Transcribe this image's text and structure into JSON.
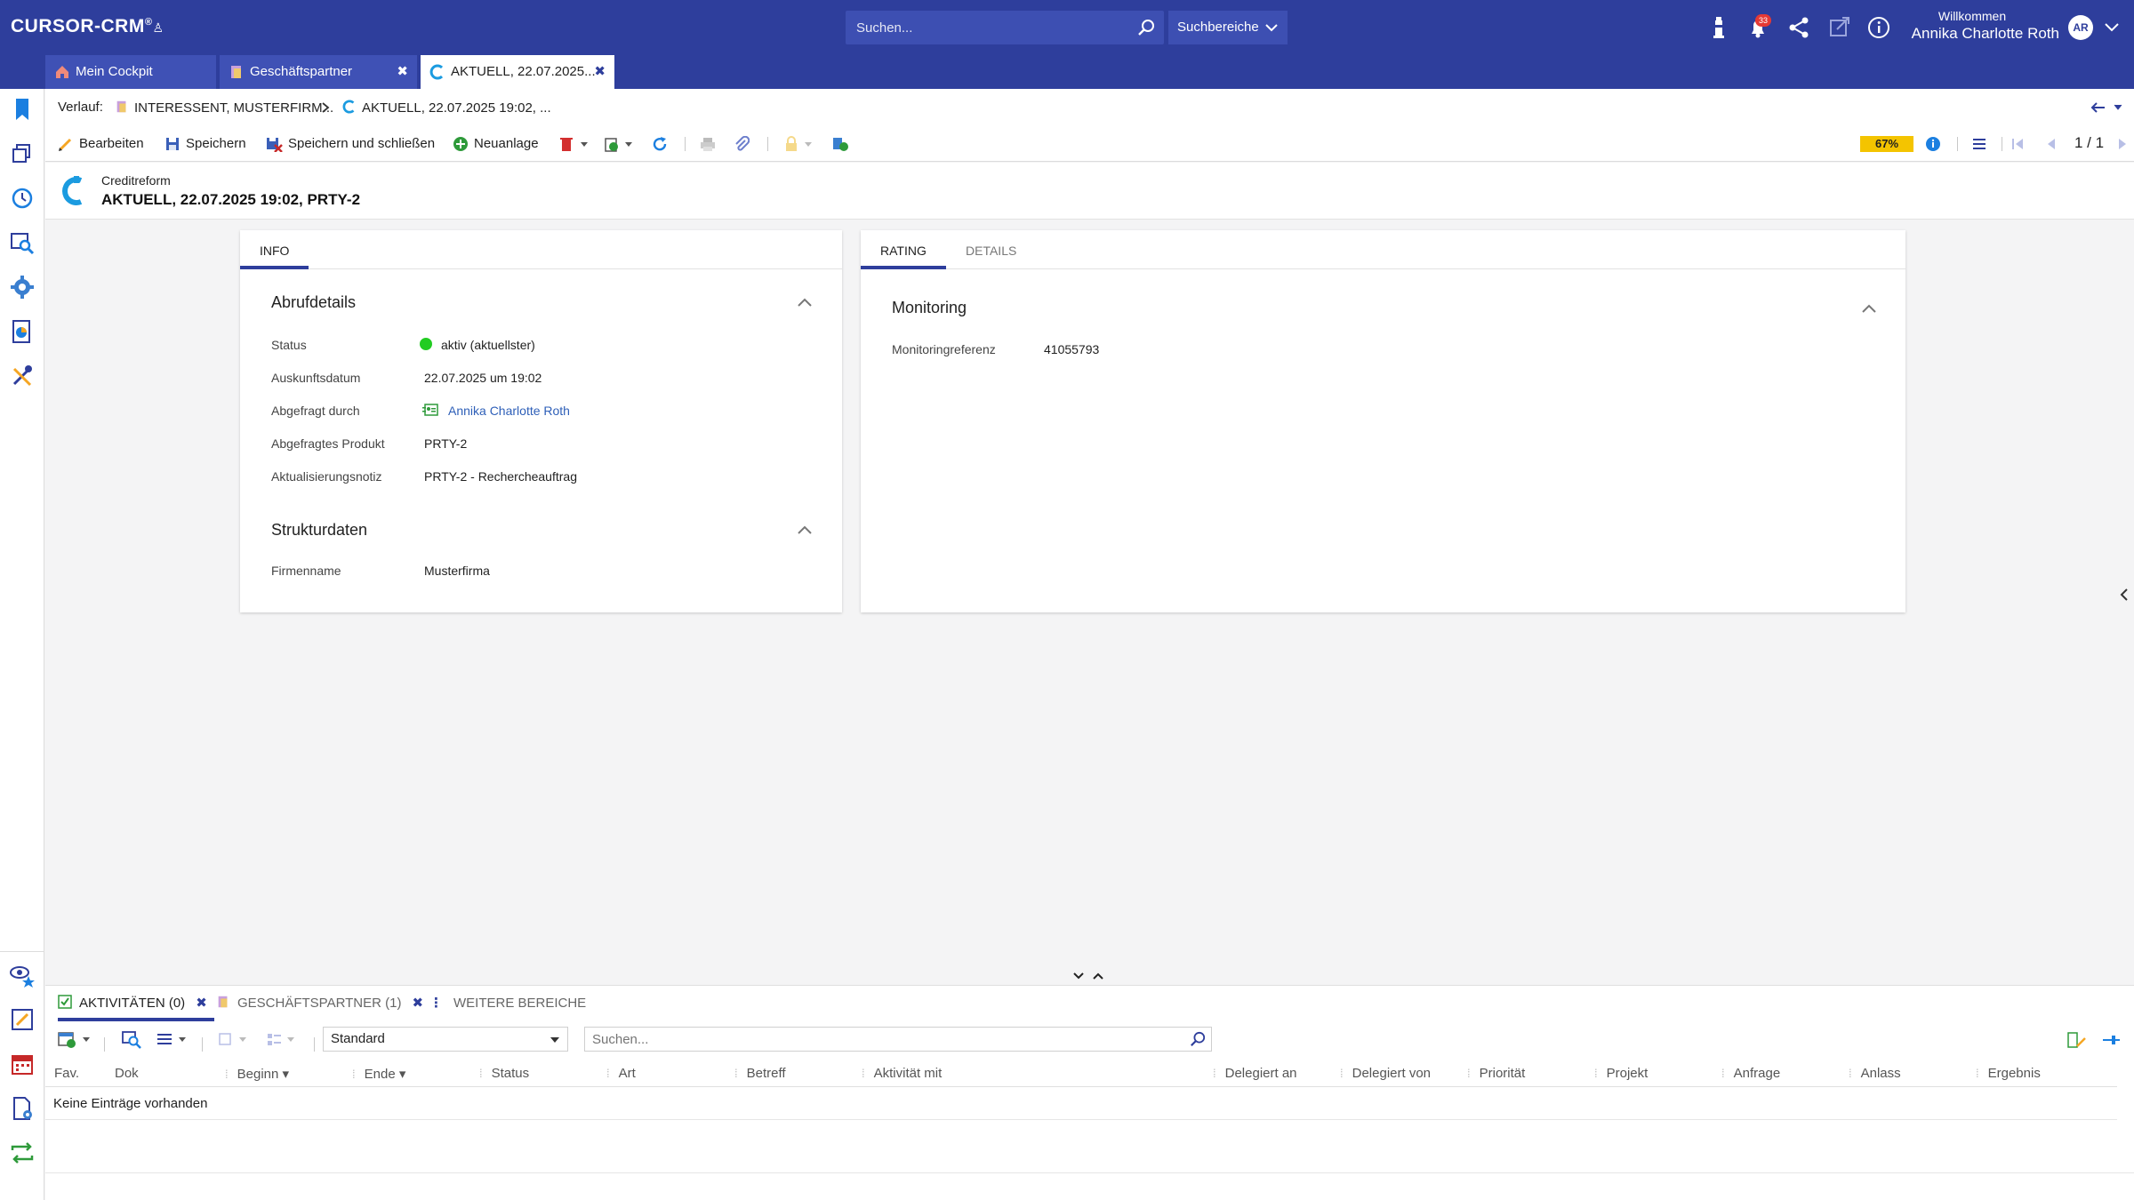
{
  "app": {
    "logo": "CURSOR-CRM",
    "accent": "#2e3e9c"
  },
  "header": {
    "search_placeholder": "Suchen...",
    "search_scope": "Suchbereiche",
    "notification_count": "33",
    "welcome_label": "Willkommen",
    "user_name": "Annika Charlotte Roth",
    "user_initials": "AR"
  },
  "tabs": [
    {
      "label": "Mein Cockpit"
    },
    {
      "label": "Geschäftspartner"
    },
    {
      "label": "AKTUELL, 22.07.2025..."
    }
  ],
  "breadcrumb": {
    "prefix": "Verlauf:",
    "items": [
      "INTERESSENT, MUSTERFIRM...",
      "AKTUELL, 22.07.2025 19:02, ..."
    ]
  },
  "toolbar": {
    "edit": "Bearbeiten",
    "save": "Speichern",
    "save_close": "Speichern und schließen",
    "new": "Neuanlage",
    "completeness": "67%",
    "pager": "1 / 1"
  },
  "record": {
    "type": "Creditreform",
    "title": "AKTUELL, 22.07.2025 19:02, PRTY-2"
  },
  "info_panel": {
    "tabs": [
      "INFO"
    ],
    "sections": {
      "abruf": {
        "title": "Abrufdetails",
        "fields": [
          {
            "label": "Status",
            "value": "aktiv (aktuellster)"
          },
          {
            "label": "Auskunftsdatum",
            "value": "22.07.2025 um 19:02"
          },
          {
            "label": "Abgefragt durch",
            "value": "Annika Charlotte Roth"
          },
          {
            "label": "Abgefragtes Produkt",
            "value": "PRTY-2"
          },
          {
            "label": "Aktualisierungsnotiz",
            "value": "PRTY-2 - Rechercheauftrag"
          }
        ]
      },
      "struktur": {
        "title": "Strukturdaten",
        "fields": [
          {
            "label": "Firmenname",
            "value": "Musterfirma"
          }
        ]
      }
    }
  },
  "rating_panel": {
    "tabs": [
      "RATING",
      "DETAILS"
    ],
    "section_title": "Monitoring",
    "fields": [
      {
        "label": "Monitoringreferenz",
        "value": "41055793"
      }
    ]
  },
  "bottom": {
    "tabs": [
      {
        "label": "AKTIVITÄTEN (0)"
      },
      {
        "label": "GESCHÄFTSPARTNER (1)"
      },
      {
        "label": "WEITERE BEREICHE"
      }
    ],
    "view_select": "Standard",
    "search_placeholder": "Suchen...",
    "columns": [
      "Fav.",
      "Dok",
      "Beginn",
      "Ende",
      "Status",
      "Art",
      "Betreff",
      "Aktivität mit",
      "Delegiert an",
      "Delegiert von",
      "Priorität",
      "Projekt",
      "Anfrage",
      "Anlass",
      "Ergebnis"
    ],
    "empty_text": "Keine Einträge vorhanden"
  }
}
